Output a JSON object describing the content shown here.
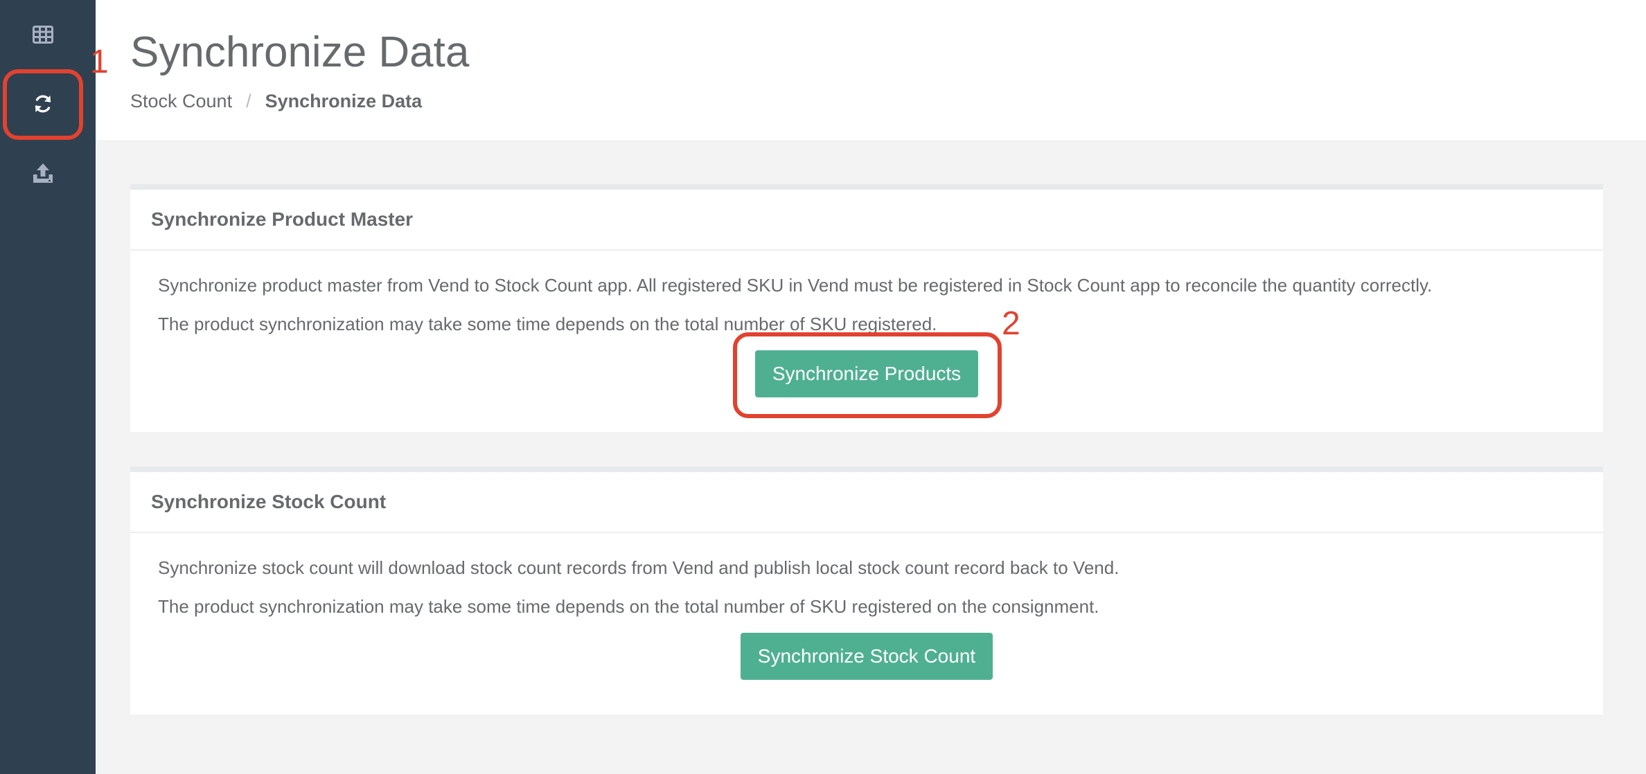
{
  "sidebar": {
    "items": [
      {
        "icon": "table-icon"
      },
      {
        "icon": "refresh-icon"
      },
      {
        "icon": "upload-icon"
      }
    ]
  },
  "header": {
    "title": "Synchronize Data",
    "breadcrumb": {
      "parent": "Stock Count",
      "separator": "/",
      "current": "Synchronize Data"
    }
  },
  "panels": [
    {
      "title": "Synchronize Product Master",
      "lines": [
        "Synchronize product master from Vend to Stock Count app. All registered SKU in Vend must be registered in Stock Count app to reconcile the quantity correctly.",
        "The product synchronization may take some time depends on the total number of SKU registered."
      ],
      "button_label": "Synchronize Products"
    },
    {
      "title": "Synchronize Stock Count",
      "lines": [
        "Synchronize stock count will download stock count records from Vend and publish local stock count record back to Vend.",
        "The product synchronization may take some time depends on the total number of SKU registered on the consignment."
      ],
      "button_label": "Synchronize Stock Count"
    }
  ],
  "annotations": {
    "step_1": "1",
    "step_2": "2"
  },
  "colors": {
    "sidebar_bg": "#2f4050",
    "button_bg": "#4fb091",
    "annotation": "#e2422f"
  }
}
